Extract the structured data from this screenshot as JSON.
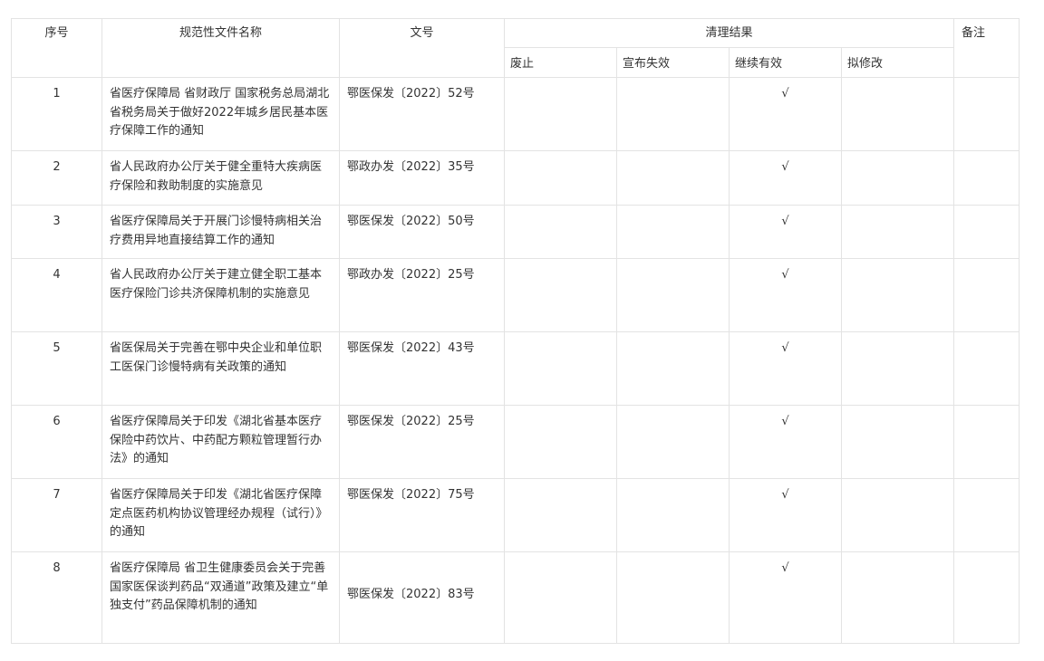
{
  "table": {
    "headers": {
      "seq": "序号",
      "name": "规范性文件名称",
      "doc_no": "文号",
      "result": "清理结果",
      "remark": "备注",
      "sub": [
        "废止",
        "宣布失效",
        "继续有效",
        "拟修改"
      ]
    },
    "rows": [
      {
        "seq": "1",
        "name": "省医疗保障局 省财政厅 国家税务总局湖北省税务局关于做好2022年城乡居民基本医疗保障工作的通知",
        "doc_no": "鄂医保发〔2022〕52号",
        "abolish": "",
        "invalid": "",
        "valid": "√",
        "revise": "",
        "remark": ""
      },
      {
        "seq": "2",
        "name": "省人民政府办公厅关于健全重特大疾病医疗保险和救助制度的实施意见",
        "doc_no": "鄂政办发〔2022〕35号",
        "abolish": "",
        "invalid": "",
        "valid": "√",
        "revise": "",
        "remark": ""
      },
      {
        "seq": "3",
        "name": "省医疗保障局关于开展门诊慢特病相关治疗费用异地直接结算工作的通知",
        "doc_no": "鄂医保发〔2022〕50号",
        "abolish": "",
        "invalid": "",
        "valid": "√",
        "revise": "",
        "remark": ""
      },
      {
        "seq": "4",
        "name": "省人民政府办公厅关于建立健全职工基本医疗保险门诊共济保障机制的实施意见",
        "doc_no": "鄂政办发〔2022〕25号",
        "abolish": "",
        "invalid": "",
        "valid": "√",
        "revise": "",
        "remark": ""
      },
      {
        "seq": "5",
        "name": "省医保局关于完善在鄂中央企业和单位职工医保门诊慢特病有关政策的通知",
        "doc_no": "鄂医保发〔2022〕43号",
        "abolish": "",
        "invalid": "",
        "valid": "√",
        "revise": "",
        "remark": ""
      },
      {
        "seq": "6",
        "name": "省医疗保障局关于印发《湖北省基本医疗保险中药饮片、中药配方颗粒管理暂行办法》的通知",
        "doc_no": "鄂医保发〔2022〕25号",
        "abolish": "",
        "invalid": "",
        "valid": "√",
        "revise": "",
        "remark": ""
      },
      {
        "seq": "7",
        "name": "省医疗保障局关于印发《湖北省医疗保障定点医药机构协议管理经办规程（试行）》的通知",
        "doc_no": "鄂医保发〔2022〕75号",
        "abolish": "",
        "invalid": "",
        "valid": "√",
        "revise": "",
        "remark": ""
      },
      {
        "seq": "8",
        "name": "省医疗保障局 省卫生健康委员会关于完善国家医保谈判药品“双通道”政策及建立“单独支付”药品保障机制的通知",
        "doc_no": "鄂医保发〔2022〕83号",
        "abolish": "",
        "invalid": "",
        "valid": "√",
        "revise": "",
        "remark": ""
      }
    ]
  }
}
